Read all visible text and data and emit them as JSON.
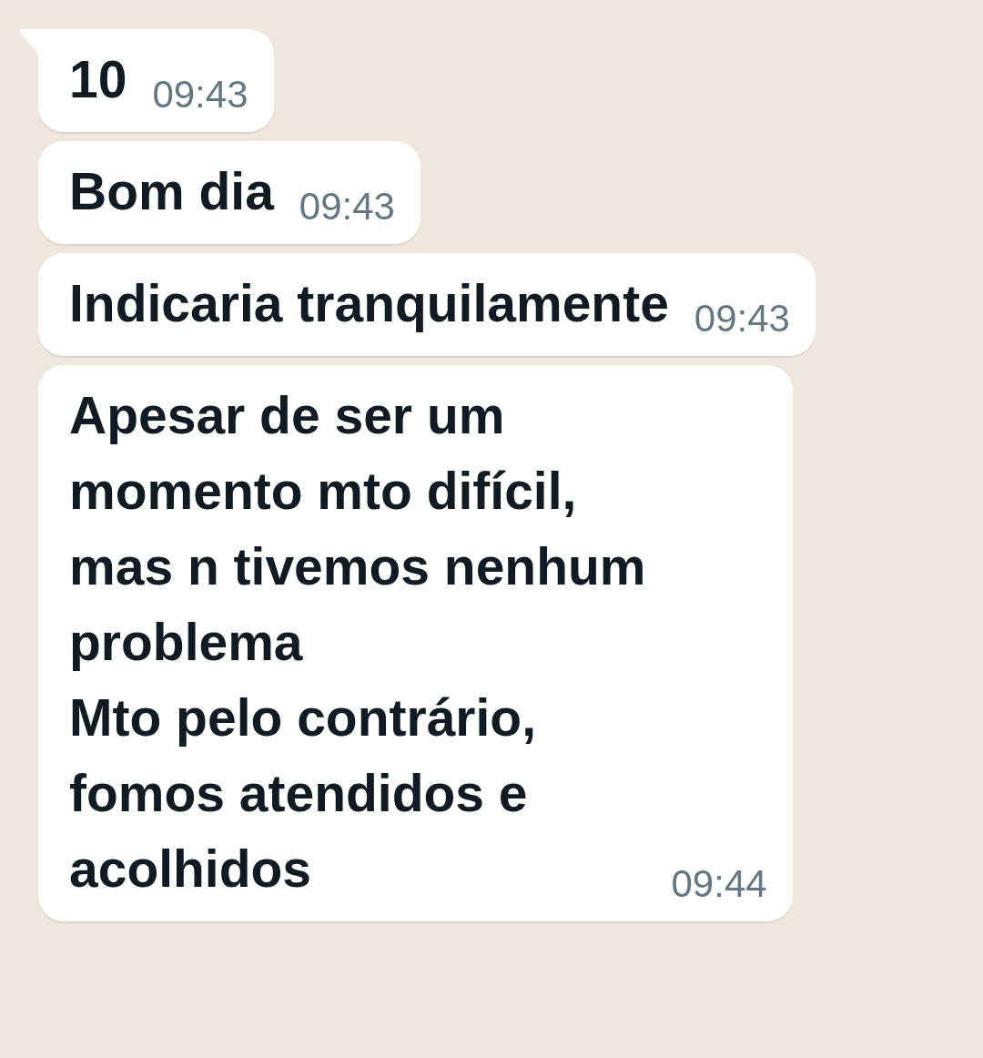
{
  "messages": [
    {
      "text": "10",
      "time": "09:43",
      "tail": true
    },
    {
      "text": "Bom dia",
      "time": "09:43",
      "tail": false
    },
    {
      "text": "Indicaria tranquilamente",
      "time": "09:43",
      "tail": false
    },
    {
      "text": "Apesar de ser um\nmomento mto difícil,\nmas n tivemos nenhum\nproblema\nMto pelo contrário,\nfomos atendidos e\nacolhidos",
      "time": "09:44",
      "tail": false
    }
  ]
}
